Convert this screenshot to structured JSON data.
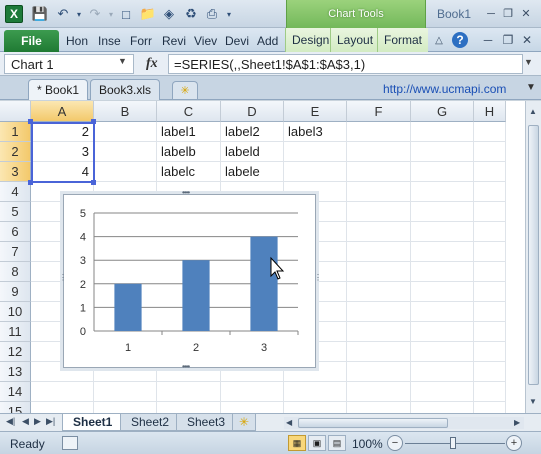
{
  "titlebar": {
    "app_icon": "X",
    "context_label": "Chart Tools",
    "window_title": "Book1",
    "qat_icons": [
      "save-icon",
      "undo-icon",
      "redo-icon",
      "new-icon",
      "open-icon",
      "chart-icon",
      "sync-icon",
      "customize-icon"
    ],
    "window_buttons": [
      "minimize-icon",
      "restore-icon",
      "close-icon"
    ]
  },
  "ribbon": {
    "file_label": "File",
    "tabs": [
      "Hon",
      "Inse",
      "Forr",
      "Revi",
      "Viev",
      "Devi",
      "Add"
    ],
    "context_tabs": [
      "Design",
      "Layout",
      "Format"
    ]
  },
  "formula_bar": {
    "name_box": "Chart 1",
    "fx_label": "fx",
    "formula": "=SERIES(,,Sheet1!$A$1:$A$3,1)"
  },
  "workbook_tabs": {
    "tabs": [
      "* Book1",
      "Book3.xls"
    ],
    "active": 0,
    "link": "http://www.ucmapi.com"
  },
  "grid": {
    "columns": [
      "A",
      "B",
      "C",
      "D",
      "E",
      "F",
      "G",
      "H"
    ],
    "rows": [
      "1",
      "2",
      "3",
      "4",
      "5",
      "6",
      "7",
      "8",
      "9",
      "10",
      "11",
      "12",
      "13",
      "14",
      "15"
    ],
    "cells": [
      [
        "2",
        "",
        "label1",
        "label2",
        "label3"
      ],
      [
        "3",
        "",
        "labelb",
        "labeld",
        ""
      ],
      [
        "4",
        "",
        "labelc",
        "labele",
        ""
      ]
    ]
  },
  "chart_data": {
    "type": "bar",
    "categories": [
      "1",
      "2",
      "3"
    ],
    "values": [
      2,
      3,
      4
    ],
    "ylim": [
      0,
      5
    ],
    "yticks": [
      "0",
      "1",
      "2",
      "3",
      "4",
      "5"
    ],
    "grid": true,
    "bar_color": "#4f81bd",
    "legend": "none"
  },
  "sheet_tabs": {
    "tabs": [
      "Sheet1",
      "Sheet2",
      "Sheet3"
    ],
    "active": 0
  },
  "status_bar": {
    "ready": "Ready",
    "zoom": "100%",
    "minus": "−",
    "plus": "+"
  }
}
